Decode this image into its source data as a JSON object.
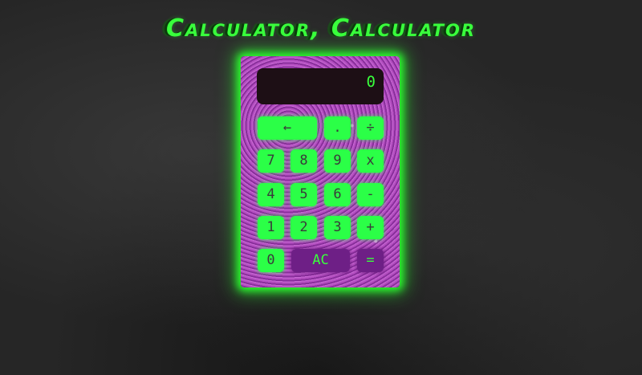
{
  "title": "Calculator, Calculator",
  "display": {
    "value": "0"
  },
  "keys": {
    "backspace": "←",
    "decimal": ".",
    "divide": "÷",
    "seven": "7",
    "eight": "8",
    "nine": "9",
    "multiply": "x",
    "four": "4",
    "five": "5",
    "six": "6",
    "subtract": "-",
    "one": "1",
    "two": "2",
    "three": "3",
    "add": "+",
    "zero": "0",
    "clear": "AC",
    "equals": "="
  },
  "colors": {
    "accent_green": "#2bff47",
    "title_green": "#39ff3c",
    "key_purple": "#6e1f86",
    "display_bg": "#1d0f15",
    "glitter_purple": "#a03fb3"
  }
}
